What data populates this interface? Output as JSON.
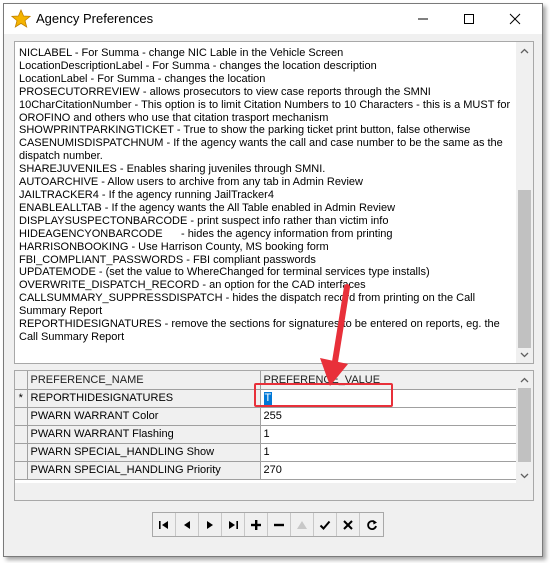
{
  "window": {
    "title": "Agency Preferences"
  },
  "memo": {
    "lines": [
      "NICLABEL - For Summa - change NIC Lable in the Vehicle Screen",
      "LocationDescriptionLabel - For Summa - changes the location description",
      "LocationLabel - For Summa - changes the location",
      "PROSECUTORREVIEW - allows prosecutors to view case reports through the SMNI",
      "10CharCitationNumber - This option is to limit Citation Numbers to 10 Characters - this is a MUST for OROFINO and others who use that citation trasport mechanism",
      "SHOWPRINTPARKINGTICKET - True to show the parking ticket print button, false otherwise",
      "CASENUMISDISPATCHNUM - If the agency wants the call and case number to be the same as the dispatch number.",
      "SHAREJUVENILES - Enables sharing juveniles through SMNI.",
      "AUTOARCHIVE - Allow users to archive from any tab in Admin Review",
      "JAILTRACKER4 - If the agency running JailTracker4",
      "ENABLEALLTAB - If the agency wants the All Table enabled in Admin Review",
      "DISPLAYSUSPECTONBARCODE - print suspect info rather than victim info",
      "HIDEAGENCYONBARCODE      - hides the agency information from printing",
      "HARRISONBOOKING - Use Harrison County, MS booking form",
      "FBI_COMPLIANT_PASSWORDS - FBI compliant passwords",
      "UPDATEMODE - (set the value to WhereChanged for terminal services type installs)",
      "OVERWRITE_DISPATCH_RECORD - an option for the CAD interfaces",
      "CALLSUMMARY_SUPPRESSDISPATCH - hides the dispatch record from printing on the Call Summary Report",
      "REPORTHIDESIGNATURES - remove the sections for signatures to be entered on reports, eg. the Call Summary Report"
    ]
  },
  "grid": {
    "headers": [
      "PREFERENCE_NAME",
      "PREFERENCE_VALUE"
    ],
    "current_row_marker": "*",
    "rows": [
      {
        "name": "REPORTHIDESIGNATURES",
        "value": "T"
      },
      {
        "name": "PWARN WARRANT Color",
        "value": "255"
      },
      {
        "name": "PWARN WARRANT Flashing",
        "value": "1"
      },
      {
        "name": "PWARN SPECIAL_HANDLING Show",
        "value": "1"
      },
      {
        "name": "PWARN SPECIAL_HANDLING Priority",
        "value": "270"
      }
    ]
  },
  "navigator": {
    "buttons": [
      "first",
      "prior",
      "next",
      "last",
      "insert",
      "delete",
      "edit",
      "post",
      "cancel",
      "refresh"
    ]
  },
  "colors": {
    "highlight": "#e8303a",
    "selection": "#0078d7",
    "star": "#f5b400"
  }
}
